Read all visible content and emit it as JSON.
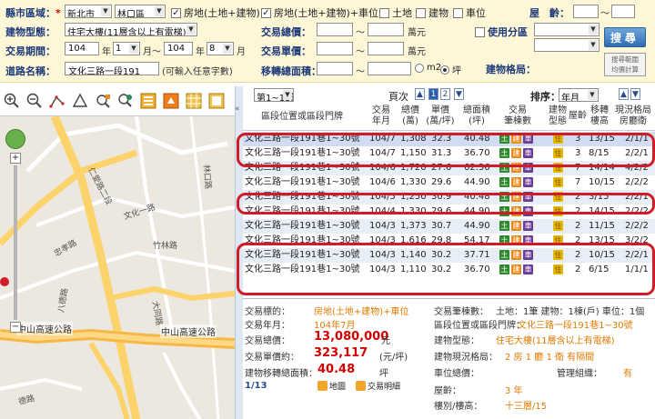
{
  "form": {
    "county_label": "縣市區域：",
    "county_value": "新北市",
    "district_value": "林口區",
    "types": [
      {
        "label": "房地(土地+建物)",
        "checked": true
      },
      {
        "label": "房地(土地+建物)+車位",
        "checked": true
      },
      {
        "label": "土地",
        "checked": false
      },
      {
        "label": "建物",
        "checked": false
      },
      {
        "label": "車位",
        "checked": false
      }
    ],
    "age_label": "屋　齡：",
    "age_sep": "～",
    "building_type_label": "建物型態：",
    "building_type_value": "住宅大樓(11層含以上有電梯)",
    "total_price_label": "交易總價：",
    "total_price_sep": "～",
    "total_price_unit": "萬元",
    "use_zone_label": "使用分區",
    "period_label": "交易期間：",
    "period_from_year": "104",
    "period_from_month": "1",
    "period_to_year": "104",
    "period_to_month": "8",
    "unit_year": "年",
    "unit_month": "月",
    "unit_to": "月～",
    "unit_price_label": "交易單價：",
    "unit_price_sep": "～",
    "unit_price_unit": "萬元",
    "road_label": "道路名稱：",
    "road_value": "文化三路一段191",
    "road_hint": "(可輸入任意字數)",
    "area_label": "移轉總面積：",
    "area_sep": "～",
    "area_unit_m2": "m2",
    "area_unit_ping": "坪",
    "layout_label": "建物格局：",
    "search_button": "搜尋",
    "range_button_line1": "搜尋範圍",
    "range_button_line2": "均價計算"
  },
  "map": {
    "highway_1": "中山高速公路",
    "highway_2": "中山高速公路",
    "labels": [
      "仁愛路二段",
      "林口路",
      "八德路",
      "文化一路",
      "大同路",
      "竹林路",
      "忠孝路",
      "德路"
    ]
  },
  "results": {
    "page_select": "第1~13筆",
    "pages_label": "頁次",
    "pages": [
      "1",
      "2"
    ],
    "current_page": "1",
    "sort_label": "排序：",
    "sort_value": "年月",
    "headers": {
      "address": "區段位置或區段門牌",
      "date": "交易\n年月",
      "total": "總價\n(萬)",
      "unit": "單價\n(萬/坪)",
      "area": "總面積\n(坪)",
      "count": "交易\n筆棟數",
      "btype": "建物\n型態",
      "age": "屋齡",
      "floor": "移轉\n樓高",
      "layout": "現況格局\n房廳衛"
    },
    "rows": [
      {
        "address": "文化三路一段191巷1~30號",
        "date": "104/7",
        "total": "1,308",
        "unit": "32.3",
        "area": "40.48",
        "age": "3",
        "floor": "13/15",
        "layout": "2/1/1"
      },
      {
        "address": "文化三路一段191巷1~30號",
        "date": "104/7",
        "total": "1,150",
        "unit": "31.3",
        "area": "36.70",
        "age": "3",
        "floor": "8/15",
        "layout": "2/2/1"
      },
      {
        "address": "文化三路一段191巷1~30號",
        "date": "104/6",
        "total": "1,720",
        "unit": "27.6",
        "area": "62.36",
        "age": "7",
        "floor": "14/14",
        "layout": "4/2/2"
      },
      {
        "address": "文化三路一段191巷1~30號",
        "date": "104/6",
        "total": "1,330",
        "unit": "29.6",
        "area": "44.90",
        "age": "7",
        "floor": "10/15",
        "layout": "2/2/2"
      },
      {
        "address": "文化三路一段191巷1~30號",
        "date": "104/5",
        "total": "1,250",
        "unit": "30.9",
        "area": "40.48",
        "age": "2",
        "floor": "3/15",
        "layout": "2/2/1"
      },
      {
        "address": "文化三路一段191巷1~30號",
        "date": "104/4",
        "total": "1,330",
        "unit": "29.6",
        "area": "44.90",
        "age": "2",
        "floor": "14/15",
        "layout": "2/2/2"
      },
      {
        "address": "文化三路一段191巷1~30號",
        "date": "104/3",
        "total": "1,373",
        "unit": "30.7",
        "area": "44.90",
        "age": "2",
        "floor": "11/15",
        "layout": "2/2/2"
      },
      {
        "address": "文化三路一段191巷1~30號",
        "date": "104/3",
        "total": "1,616",
        "unit": "29.8",
        "area": "54.17",
        "age": "2",
        "floor": "13/15",
        "layout": "3/2/2"
      },
      {
        "address": "文化三路一段191巷1~30號",
        "date": "104/3",
        "total": "1,140",
        "unit": "30.2",
        "area": "37.71",
        "age": "2",
        "floor": "10/15",
        "layout": "2/2/1"
      },
      {
        "address": "文化三路一段191巷1~30號",
        "date": "104/3",
        "total": "1,110",
        "unit": "30.2",
        "area": "36.70",
        "age": "2",
        "floor": "6/15",
        "layout": "1/1/1"
      }
    ],
    "tags": {
      "land": "土",
      "building": "建",
      "parking": "車",
      "residence": "住"
    }
  },
  "detail": {
    "target_label": "交易標的：",
    "target_value": "房地(土地+建物)+車位",
    "ym_label": "交易年月：",
    "ym_value": "104年7月",
    "total_label": "交易總價：",
    "total_value": "13,080,000",
    "total_unit": "元",
    "unit_label": "交易單價約：",
    "unit_value": "323,117",
    "unit_unit": "(元/坪)",
    "area_label": "建物移轉總面積：",
    "area_value": "40.48",
    "area_unit": "坪",
    "index": "1/13",
    "map_btn": "地圖",
    "detail_btn": "交易明細",
    "count_label": "交易筆棟數：",
    "count_value": "土地：1筆 建物：1棟(戶) 車位：1個",
    "addr_label": "區段位置或區段門牌：",
    "addr_value": "文化三路一段191巷1~30號",
    "btype_label": "建物型態：",
    "btype_value": "住宅大樓(11層含以上有電梯)",
    "layout_label": "建物現況格局：",
    "layout_value": "2 房 1 廳 1 衛 有隔間",
    "parking_label": "車位總價：",
    "mgmt_label": "管理組織：",
    "mgmt_value": "有",
    "age_label": "屋齡：",
    "age_value": "3 年",
    "floor_label": "樓別/樓高：",
    "floor_value": "十三層/15"
  }
}
